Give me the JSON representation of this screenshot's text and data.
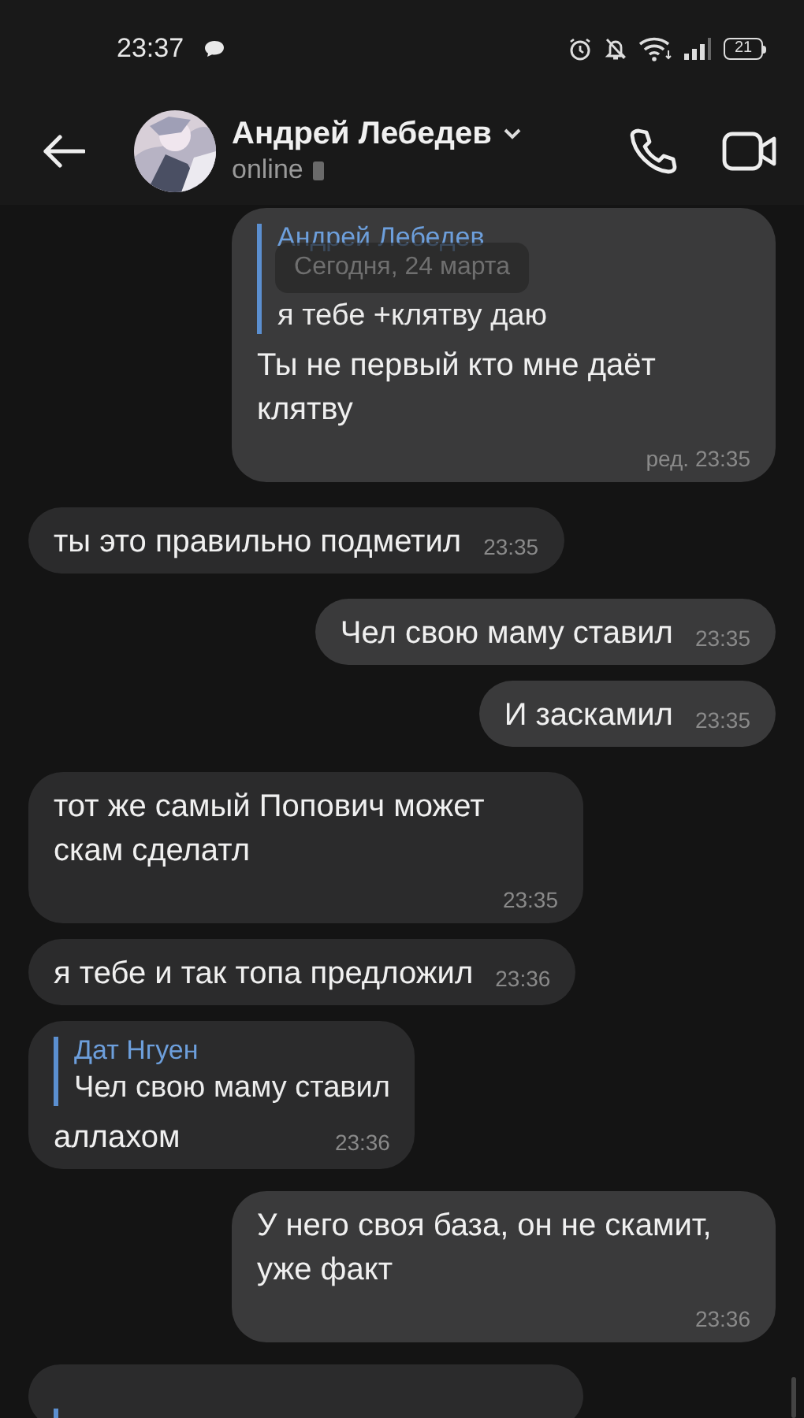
{
  "status_bar": {
    "time": "23:37",
    "battery": "21"
  },
  "header": {
    "name": "Андрей Лебедев",
    "presence": "online"
  },
  "date_badge": "Сегодня, 24 марта",
  "messages": [
    {
      "kind": "message",
      "outgoing": true,
      "reply": {
        "author": "Андрей Лебедев",
        "text": "я тебе +клятву даю"
      },
      "text": "Ты не первый кто мне даёт клятву",
      "time": "ред. 23:35"
    },
    {
      "kind": "message",
      "outgoing": false,
      "text": "ты это правильно подметил",
      "time": "23:35"
    },
    {
      "kind": "message",
      "outgoing": true,
      "text": "Чел свою маму ставил",
      "time": "23:35"
    },
    {
      "kind": "message",
      "outgoing": true,
      "text": "И заскамил",
      "time": "23:35"
    },
    {
      "kind": "message",
      "outgoing": false,
      "text": "тот же самый Попович может скам сделатл",
      "time": "23:35"
    },
    {
      "kind": "message",
      "outgoing": false,
      "text": "я тебе и так топа предложил",
      "time": "23:36"
    },
    {
      "kind": "message",
      "outgoing": false,
      "reply": {
        "author": "Дат Нгуен",
        "text": "Чел свою маму ставил"
      },
      "text": "аллахом",
      "time": "23:36"
    },
    {
      "kind": "message",
      "outgoing": true,
      "text": "У него своя база, он не скамит, уже факт",
      "time": "23:36"
    },
    {
      "kind": "partial",
      "outgoing": false
    }
  ]
}
